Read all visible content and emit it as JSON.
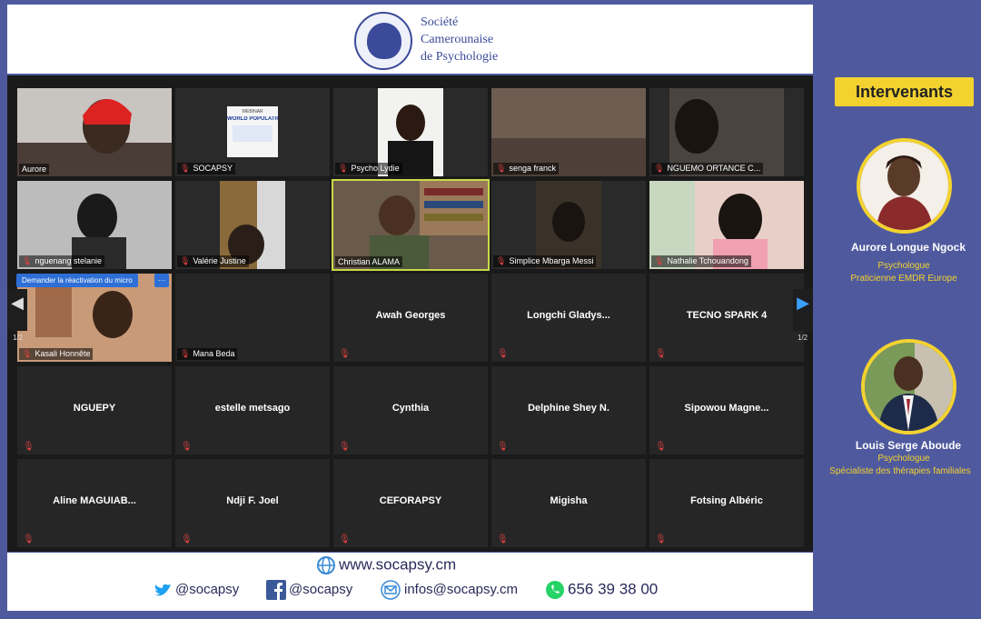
{
  "header": {
    "org_line1": "Société",
    "org_line2": "Camerounaise",
    "org_line3": "de Psychologie"
  },
  "grid": {
    "rows": [
      [
        {
          "label": "Aurore",
          "mic_off": false,
          "video": true
        },
        {
          "label": "SOCAPSY",
          "mic_off": true,
          "video": true
        },
        {
          "label": "Psycho Lydie",
          "mic_off": true,
          "video": true
        },
        {
          "label": "senga franck",
          "mic_off": true,
          "video": true
        },
        {
          "label": "NGUEMO ORTANCE C...",
          "mic_off": true,
          "video": true
        }
      ],
      [
        {
          "label": "nguenang stelanie",
          "mic_off": true,
          "video": true
        },
        {
          "label": "Valérie Justine",
          "mic_off": true,
          "video": true
        },
        {
          "label": "Christian ALAMA",
          "mic_off": false,
          "video": true,
          "active": true
        },
        {
          "label": "Simplice Mbarga Messi",
          "mic_off": true,
          "video": true
        },
        {
          "label": "Nathalie Tchouandong",
          "mic_off": true,
          "video": true
        }
      ],
      [
        {
          "label": "Kasali Honnête",
          "mic_off": true,
          "video": true
        },
        {
          "label": "Mana Beda",
          "mic_off": true,
          "video": false
        },
        {
          "name": "Awah Georges"
        },
        {
          "name": "Longchi  Gladys..."
        },
        {
          "name": "TECNO SPARK 4"
        }
      ],
      [
        {
          "name": "NGUEPY"
        },
        {
          "name": "estelle metsago"
        },
        {
          "name": "Cynthia"
        },
        {
          "name": "Delphine Shey N."
        },
        {
          "name": "Sipowou  Magne..."
        }
      ],
      [
        {
          "name": "Aline  MAGUIAB..."
        },
        {
          "name": "Ndji F. Joel"
        },
        {
          "name": "CEFORAPSY"
        },
        {
          "name": "Migisha"
        },
        {
          "name": "Fotsing Albéric"
        }
      ]
    ],
    "request_label": "Demander la réactivation du micro",
    "more_label": "···",
    "page_left": "1/2",
    "page_right": "1/2",
    "slide_title": "WORLD POPULATION DA",
    "slide_kicker": "WEBINAR"
  },
  "footer": {
    "website": "www.socapsy.cm",
    "twitter": "@socapsy",
    "facebook": "@socapsy",
    "email": "infos@socapsy.cm",
    "phone": "656 39 38 00"
  },
  "sidebar": {
    "title": "Intervenants",
    "speakers": [
      {
        "name": "Aurore Longue Ngock",
        "role": "Psychologue",
        "detail": "Praticienne EMDR Europe"
      },
      {
        "name": "Louis Serge Aboude",
        "role": "Psychologue",
        "detail": "Spécialiste des thérapies familiales"
      }
    ]
  },
  "colors": {
    "background": "#4f5a9e",
    "accent": "#f3d230",
    "brand": "#3b4a9a",
    "active_speaker": "#c9d94a",
    "mic_muted": "#e04040"
  }
}
